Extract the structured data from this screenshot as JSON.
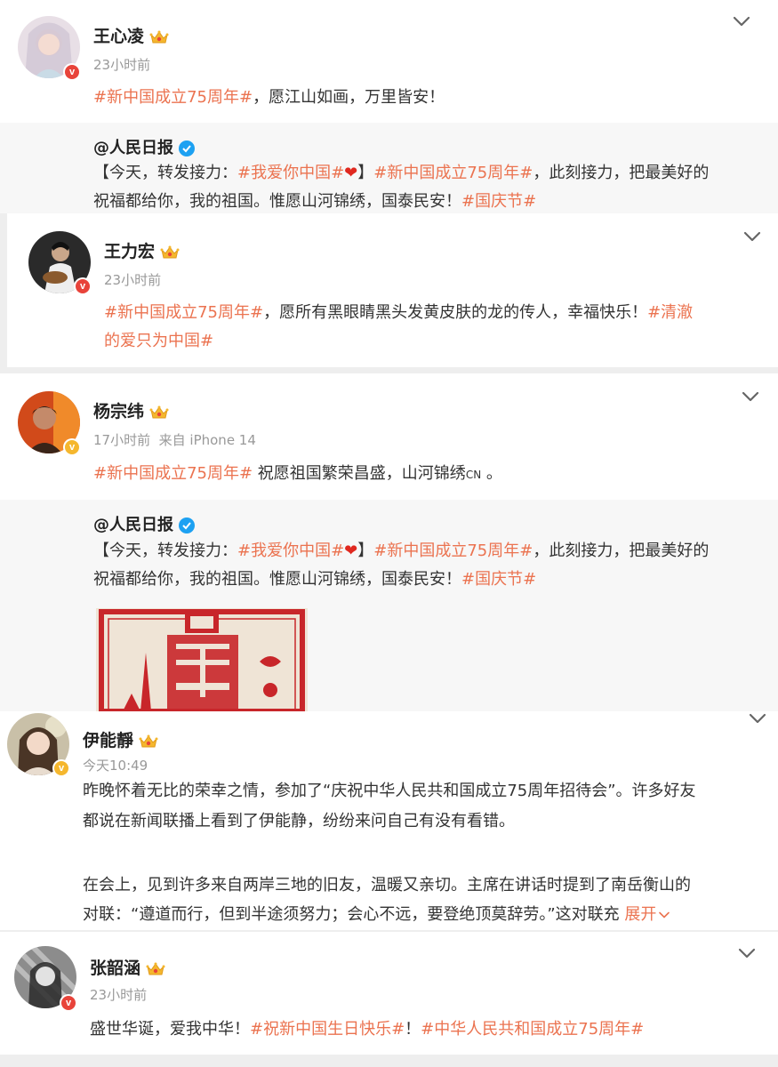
{
  "posts": [
    {
      "name": "王心凌",
      "time": "23小时前",
      "text_tag": "#新中国成立75周年#",
      "text_rest": "，愿江山如画，万里皆安！",
      "repost": {
        "author": "@人民日报",
        "line1_a": "【今天，转发接力：",
        "line1_tag1": "#我爱你中国#",
        "line1_heart": "❤",
        "line1_b": "】",
        "line1_tag2": "#新中国成立75周年#",
        "line1_c": "，此刻接力，把最美好的",
        "line2_a": "祝福都给你，我的祖国。惟愿山河锦绣，国泰民安！",
        "line2_tag": "#国庆节#"
      }
    },
    {
      "name": "王力宏",
      "time": "23小时前",
      "line1_tag": "#新中国成立75周年#",
      "line1_rest": "，愿所有黑眼睛黑头发黄皮肤的龙的传人，幸福快乐！",
      "line1_tag2": "#清澈",
      "line2_tag": "的爱只为中国#"
    },
    {
      "name": "杨宗纬",
      "time": "17小时前",
      "source": "来自 iPhone 14",
      "text_tag": "#新中国成立75周年#",
      "text_rest": " 祝愿祖国繁荣昌盛，山河锦绣",
      "text_cn": "CN",
      "text_end": " 。",
      "repost": {
        "author": "@人民日报",
        "line1_a": "【今天，转发接力：",
        "line1_tag1": "#我爱你中国#",
        "line1_heart": "❤",
        "line1_b": "】",
        "line1_tag2": "#新中国成立75周年#",
        "line1_c": "，此刻接力，把最美好的",
        "line2_a": "祝福都给你，我的祖国。惟愿山河锦绣，国泰民安！",
        "line2_tag": "#国庆节#"
      }
    },
    {
      "name": "伊能靜",
      "time": "今天10:49",
      "p1_line1": "昨晚怀着无比的荣幸之情，参加了“庆祝中华人民共和国成立75周年招待会”。许多好友",
      "p1_line2": "都说在新闻联播上看到了伊能静，纷纷来问自己有没有看错。",
      "p2_line1": "在会上，见到许多来自两岸三地的旧友，温暖又亲切。主席在讲话时提到了南岳衡山的",
      "p2_line2": "对联：“遵道而行，但到半途须努力；会心不远，要登绝顶莫辞劳。”这对联充",
      "expand": "展开"
    },
    {
      "name": "张韶涵",
      "time": "23小时前",
      "text_a": "盛世华诞，爱我中华！",
      "text_tag1": "#祝新中国生日快乐#",
      "text_b": "！",
      "text_tag2": "#中华人民共和国成立75周年#"
    }
  ],
  "colors": {
    "topic": "#eb7350",
    "verified_red": "#e8433a",
    "verified_gold": "#f5b72e",
    "verified_blue": "#1da1f2"
  }
}
